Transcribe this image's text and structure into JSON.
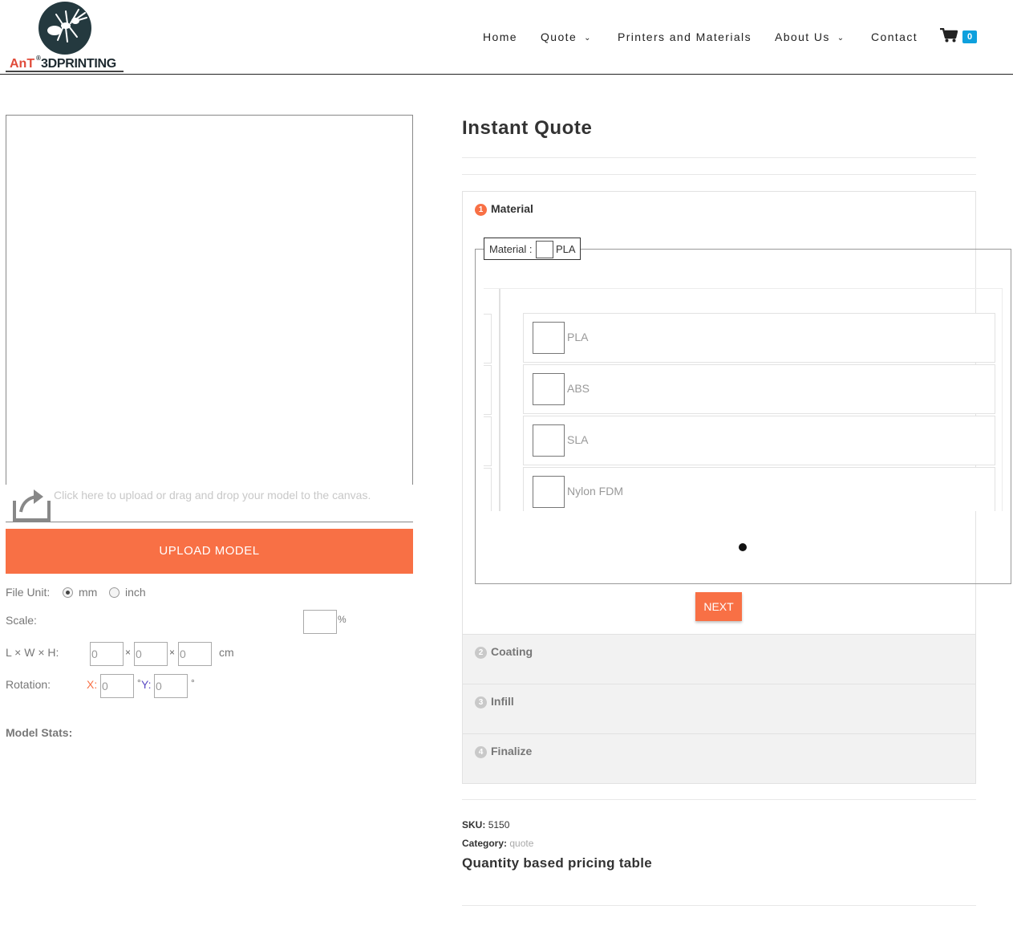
{
  "brand": {
    "name_part1": "AnT",
    "reg": "®",
    "name_part2": "3DPRINTING"
  },
  "nav": {
    "items": [
      {
        "label": "Home",
        "has_dropdown": false
      },
      {
        "label": "Quote",
        "has_dropdown": true
      },
      {
        "label": "Printers and Materials",
        "has_dropdown": false
      },
      {
        "label": "About Us",
        "has_dropdown": true
      },
      {
        "label": "Contact",
        "has_dropdown": false
      }
    ],
    "cart_count": "0",
    "cart_icon": "cart-icon",
    "badge_color": "#0ea0dd"
  },
  "viewer": {
    "upload_hint": "Click here to upload or drag and drop your model to the canvas.",
    "upload_icon": "upload-icon",
    "upload_button": "UPLOAD MODEL"
  },
  "settings": {
    "file_unit_label": "File Unit:",
    "unit_options": [
      "mm",
      "inch"
    ],
    "unit_selected": "mm",
    "scale_label": "Scale:",
    "scale_value": "",
    "scale_unit": "%",
    "dims_label": "L × W × H:",
    "dims": [
      "0",
      "0",
      "0"
    ],
    "dims_sep": "×",
    "dims_unit": "cm",
    "rotation_label": "Rotation:",
    "rotation_x_label": "X:",
    "rotation_y_label": "Y:",
    "rotation_x": "0",
    "rotation_y": "0",
    "degree": "°",
    "stats_label": "Model Stats:"
  },
  "quote": {
    "title": "Instant Quote",
    "steps": [
      {
        "num": "1",
        "title": "Material",
        "active": true
      },
      {
        "num": "2",
        "title": "Coating",
        "active": false
      },
      {
        "num": "3",
        "title": "Infill",
        "active": false
      },
      {
        "num": "4",
        "title": "Finalize",
        "active": false
      }
    ],
    "material_legend_label": "Material :",
    "material_selected": "PLA",
    "materials": [
      "PLA",
      "ABS",
      "SLA",
      "Nylon FDM"
    ],
    "next_button": "NEXT",
    "accent_color": "#f87045"
  },
  "product_meta": {
    "sku_label": "SKU:",
    "sku": "5150",
    "category_label": "Category:",
    "category": "quote",
    "pricing_title": "Quantity based pricing table"
  }
}
